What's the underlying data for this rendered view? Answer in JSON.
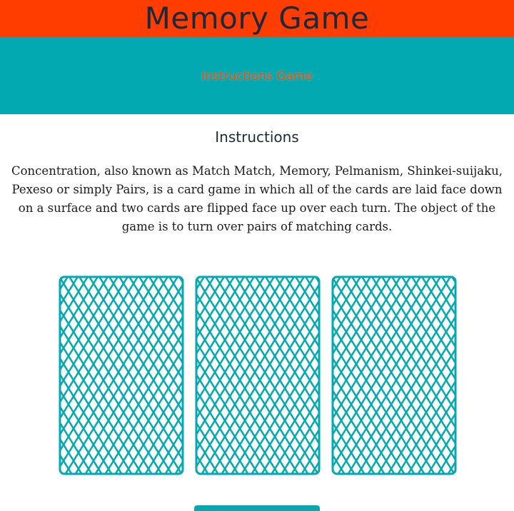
{
  "header": {
    "title": "Memory Game"
  },
  "nav": {
    "instructions_label": "Instructions",
    "game_label": "Game"
  },
  "instructions": {
    "title": "Instructions",
    "body": "Concentration, also known as Match Match, Memory, Pelmanism, Shinkei-suijaku, Pexeso or simply Pairs, is a card game in which all of the cards are laid face down on a surface and two cards are flipped face up over each turn. The object of the game is to turn over pairs of matching cards."
  },
  "cards": {
    "count": 3,
    "state": "face-down"
  },
  "colors": {
    "header_bg": "#ff3d00",
    "nav_bg": "#02a9b0",
    "nav_link": "#ff4500",
    "title_text": "#1b2a3a",
    "card_pattern": "#02a9b0"
  }
}
